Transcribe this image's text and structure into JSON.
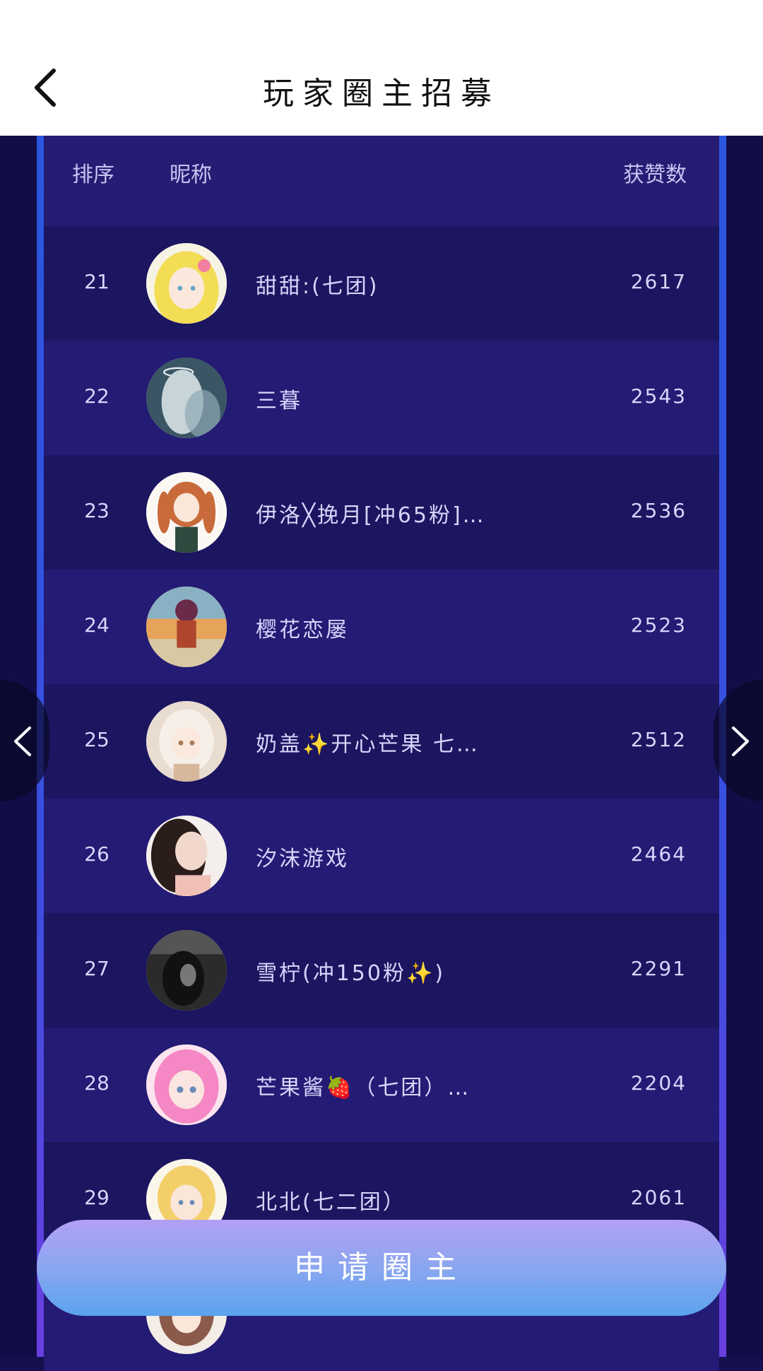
{
  "header": {
    "title": "玩家圈主招募",
    "back_icon": "chevron-left-icon"
  },
  "table": {
    "col_rank": "排序",
    "col_nickname": "昵称",
    "col_likes": "获赞数"
  },
  "rows": [
    {
      "rank": "21",
      "nickname": "甜甜:(七团)",
      "likes": "2617"
    },
    {
      "rank": "22",
      "nickname": "三暮",
      "likes": "2543"
    },
    {
      "rank": "23",
      "nickname": "伊洛╳挽月[冲65粉]…",
      "likes": "2536"
    },
    {
      "rank": "24",
      "nickname": "樱花恋屡",
      "likes": "2523"
    },
    {
      "rank": "25",
      "nickname": "奶盖✨开心芒果 七…",
      "likes": "2512"
    },
    {
      "rank": "26",
      "nickname": "汐沫游戏",
      "likes": "2464"
    },
    {
      "rank": "27",
      "nickname": "雪柠(冲150粉✨)",
      "likes": "2291"
    },
    {
      "rank": "28",
      "nickname": "芒果酱🍓（七团）…",
      "likes": "2204"
    },
    {
      "rank": "29",
      "nickname": "北北(七二团）",
      "likes": "2061"
    },
    {
      "rank": "",
      "nickname": "",
      "likes": ""
    }
  ],
  "nav": {
    "prev_icon": "chevron-left-icon",
    "next_icon": "chevron-right-icon"
  },
  "apply_button": "申请圈主",
  "colors": {
    "accent_blue": "#2a56e0",
    "row_dark": "#1c1560",
    "row_light": "#241b74",
    "button_top": "#b2a0f5",
    "button_bottom": "#5aa3ee"
  }
}
